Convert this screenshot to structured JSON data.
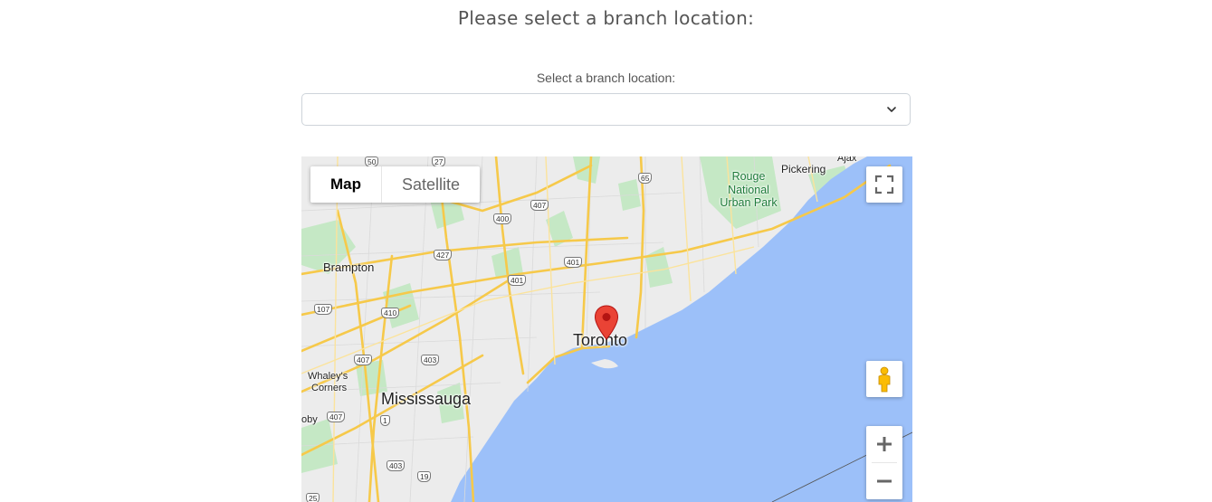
{
  "page": {
    "heading": "Please select a branch location:",
    "select_label": "Select a branch location:",
    "select_value": ""
  },
  "map": {
    "type_controls": {
      "map": "Map",
      "satellite": "Satellite",
      "selected": "Map"
    },
    "labels": {
      "toronto": "Toronto",
      "mississauga": "Mississauga",
      "brampton": "Brampton",
      "pickering": "Pickering",
      "ajax": "Ajax",
      "rouge": "Rouge",
      "national": "National",
      "urban_park": "Urban Park",
      "whaleys": "Whaley's",
      "corners": "Corners",
      "oby": "oby"
    },
    "highway_shields": [
      "50",
      "27",
      "407",
      "400",
      "65",
      "427",
      "401",
      "401",
      "107",
      "410",
      "407",
      "403",
      "407",
      "1",
      "403",
      "19",
      "25"
    ],
    "icons": [
      "fullscreen-icon",
      "pegman-icon",
      "zoom-in-icon",
      "zoom-out-icon",
      "map-marker-icon"
    ],
    "colors": {
      "water": "#9cc0f9",
      "land": "#ececec",
      "highway": "#f6c94a",
      "park": "#c5e8c5",
      "marker": "#ea4335"
    }
  }
}
